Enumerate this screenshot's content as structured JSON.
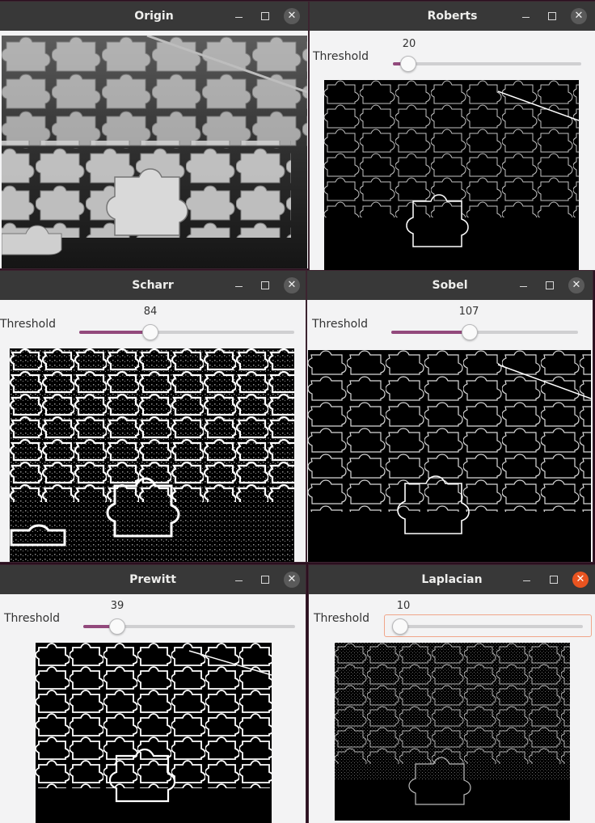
{
  "windows": {
    "origin": {
      "title": "Origin"
    },
    "roberts": {
      "title": "Roberts",
      "label": "Threshold",
      "value": "20",
      "fraction": 0.08
    },
    "scharr": {
      "title": "Scharr",
      "label": "Threshold",
      "value": "84",
      "fraction": 0.33
    },
    "sobel": {
      "title": "Sobel",
      "label": "Threshold",
      "value": "107",
      "fraction": 0.42
    },
    "prewitt": {
      "title": "Prewitt",
      "label": "Threshold",
      "value": "39",
      "fraction": 0.16
    },
    "laplacian": {
      "title": "Laplacian",
      "label": "Threshold",
      "value": "10",
      "fraction": 0.04
    }
  },
  "icons": {
    "minimize": "minimize-icon",
    "maximize": "maximize-icon",
    "close": "close-icon"
  },
  "colors": {
    "slider_fill": "#92497c",
    "active_close": "#e95420",
    "titlebar": "#383838"
  }
}
